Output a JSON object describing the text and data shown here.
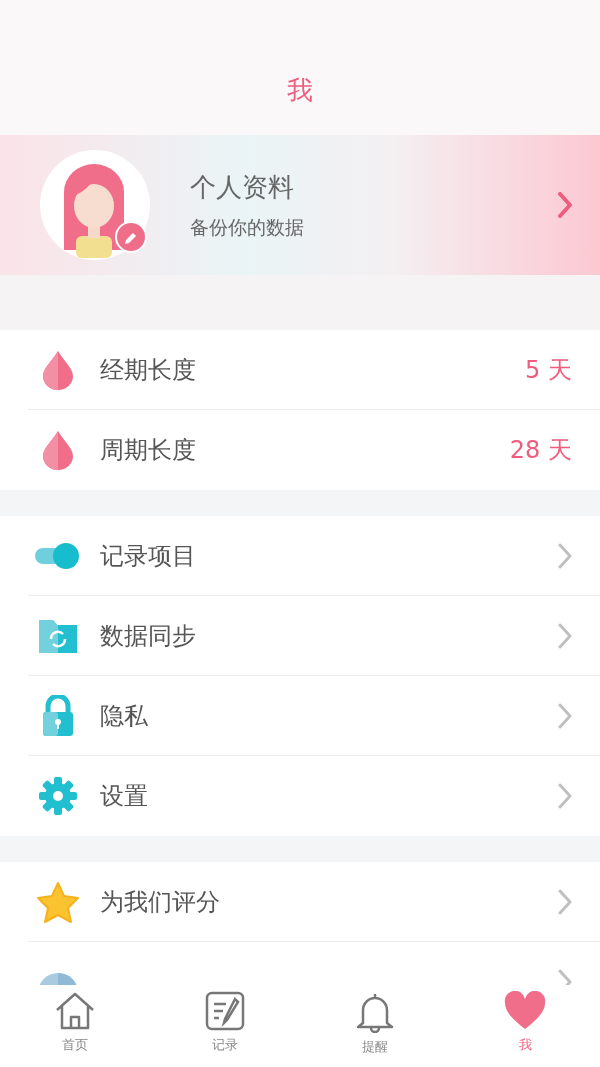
{
  "header": {
    "title": "我"
  },
  "profile": {
    "name": "个人资料",
    "subtitle": "备份你的数据"
  },
  "sections": [
    {
      "rows": [
        {
          "kind": "value",
          "label": "经期长度",
          "value": "5 天"
        },
        {
          "kind": "value",
          "label": "周期长度",
          "value": "28 天"
        }
      ]
    },
    {
      "rows": [
        {
          "kind": "link",
          "label": "记录项目"
        },
        {
          "kind": "link",
          "label": "数据同步"
        },
        {
          "kind": "link",
          "label": "隐私"
        },
        {
          "kind": "link",
          "label": "设置"
        }
      ]
    },
    {
      "rows": [
        {
          "kind": "link",
          "label": "为我们评分"
        },
        {
          "kind": "link"
        }
      ]
    }
  ],
  "tabs": [
    {
      "label": "首页",
      "selected": false
    },
    {
      "label": "记录",
      "selected": false
    },
    {
      "label": "提醒",
      "selected": false
    },
    {
      "label": "我",
      "selected": true
    }
  ]
}
